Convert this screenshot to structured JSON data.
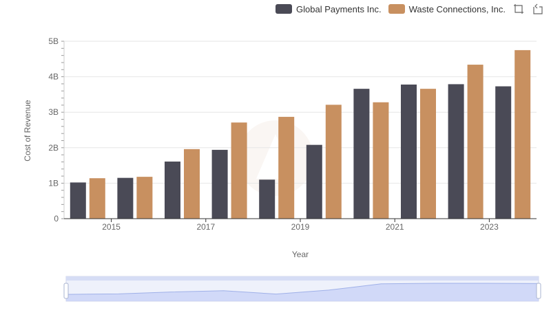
{
  "chart_data": {
    "type": "bar",
    "title": "",
    "xlabel": "Year",
    "ylabel": "Cost of Revenue",
    "categories": [
      "2014",
      "2015",
      "2016",
      "2017",
      "2018",
      "2019",
      "2020",
      "2021",
      "2022",
      "2023"
    ],
    "x_tick_labels": [
      "2015",
      "2017",
      "2019",
      "2021",
      "2023"
    ],
    "y_tick_labels": [
      "0",
      "1B",
      "2B",
      "3B",
      "4B",
      "5B"
    ],
    "ylim": [
      0,
      5000000000
    ],
    "grid": true,
    "legend_position": "top-right",
    "series": [
      {
        "name": "Global Payments Inc.",
        "color": "#4a4a56",
        "values": [
          1020000000,
          1150000000,
          1610000000,
          1940000000,
          1100000000,
          2080000000,
          3660000000,
          3780000000,
          3790000000,
          3730000000
        ]
      },
      {
        "name": "Waste Connections, Inc.",
        "color": "#c89060",
        "values": [
          1140000000,
          1180000000,
          1960000000,
          2710000000,
          2870000000,
          3210000000,
          3280000000,
          3660000000,
          4340000000,
          4750000000
        ]
      }
    ],
    "zoom_slider": {
      "start": 0,
      "end": 1
    }
  },
  "toolbar": {
    "icons": [
      "zoom-icon",
      "reset-zoom-icon"
    ]
  }
}
